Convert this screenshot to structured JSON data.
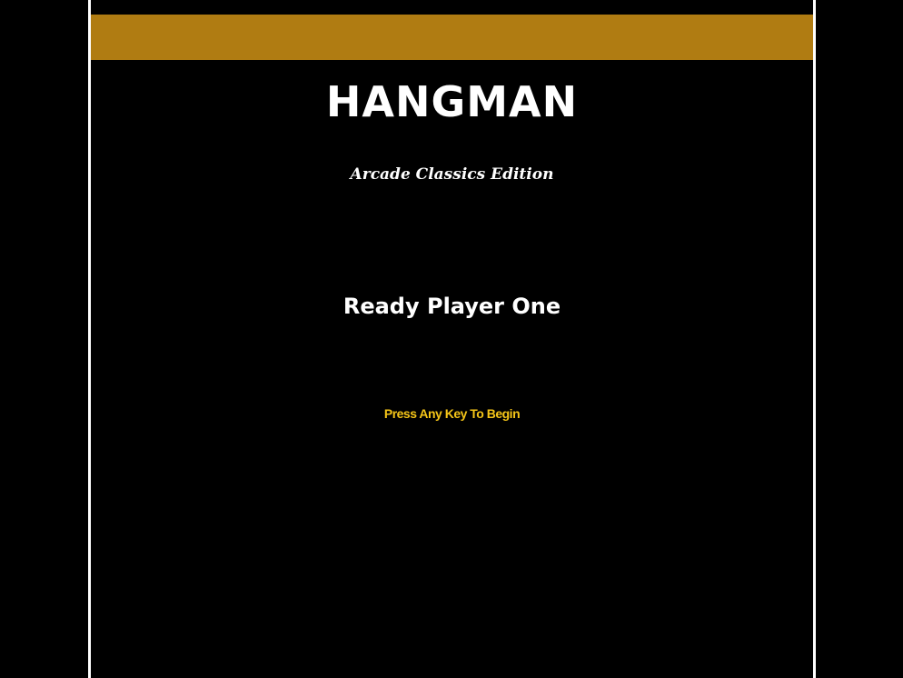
{
  "colors": {
    "background": "#000000",
    "frame_border": "#ffffff",
    "banner": "#b07c12",
    "title_text": "#ffffff",
    "prompt_text": "#f5c518"
  },
  "game": {
    "title": "HANGMAN",
    "subtitle": "Arcade Classics Edition",
    "status": "Ready Player One",
    "prompt": "Press Any Key To Begin"
  }
}
